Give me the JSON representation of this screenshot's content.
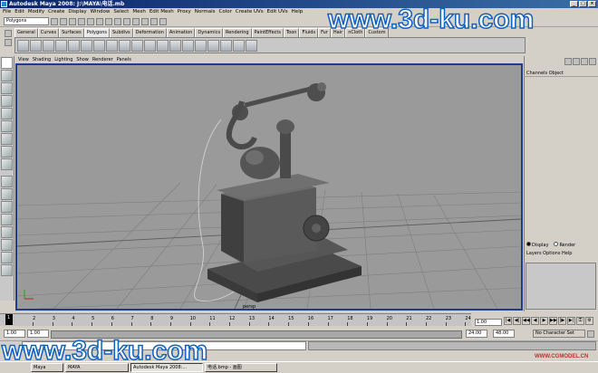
{
  "window": {
    "title": "Autodesk Maya 2008: J:\\MAYA\\电话.mb"
  },
  "menu": [
    "File",
    "Edit",
    "Modify",
    "Create",
    "Display",
    "Window",
    "Select",
    "Mesh",
    "Edit Mesh",
    "Proxy",
    "Normals",
    "Color",
    "Create UVs",
    "Edit UVs",
    "Help"
  ],
  "statusline": {
    "mode": "Polygons"
  },
  "shelf_tabs": [
    "General",
    "Curves",
    "Surfaces",
    "Polygons",
    "Subdivs",
    "Deformation",
    "Animation",
    "Dynamics",
    "Rendering",
    "PaintEffects",
    "Toon",
    "Fluids",
    "Fur",
    "Hair",
    "nCloth",
    "Custom"
  ],
  "panel_menu": [
    "View",
    "Shading",
    "Lighting",
    "Show",
    "Renderer",
    "Panels"
  ],
  "viewport": {
    "camera": "persp",
    "background": "#9a9a9a"
  },
  "channel_box": {
    "header": "Channels  Object"
  },
  "layers": {
    "display_label": "Display",
    "render_label": "Render",
    "menu": "Layers  Options  Help"
  },
  "timeline": {
    "ticks": [
      "2",
      "3",
      "4",
      "5",
      "6",
      "7",
      "8",
      "9",
      "10",
      "11",
      "12",
      "13",
      "14",
      "15",
      "16",
      "17",
      "18",
      "19",
      "20",
      "21",
      "22",
      "23",
      "24"
    ],
    "current_frame": "1",
    "current_frame_field": "1.00"
  },
  "range": {
    "start": "1.00",
    "start2": "1.00",
    "end": "24.00",
    "end2": "48.00",
    "character_set": "No Character Set"
  },
  "taskbar": [
    {
      "label": "Maya",
      "active": false
    },
    {
      "label": "MAYA",
      "active": false
    },
    {
      "label": "Autodesk Maya 2008:...",
      "active": true
    },
    {
      "label": "电话.bmp - 画图",
      "active": false
    }
  ],
  "watermarks": {
    "top": "www.3d-ku.com",
    "bottom": "www.3d-ku.com",
    "corner": "WWW.CGMODEL.CN"
  }
}
